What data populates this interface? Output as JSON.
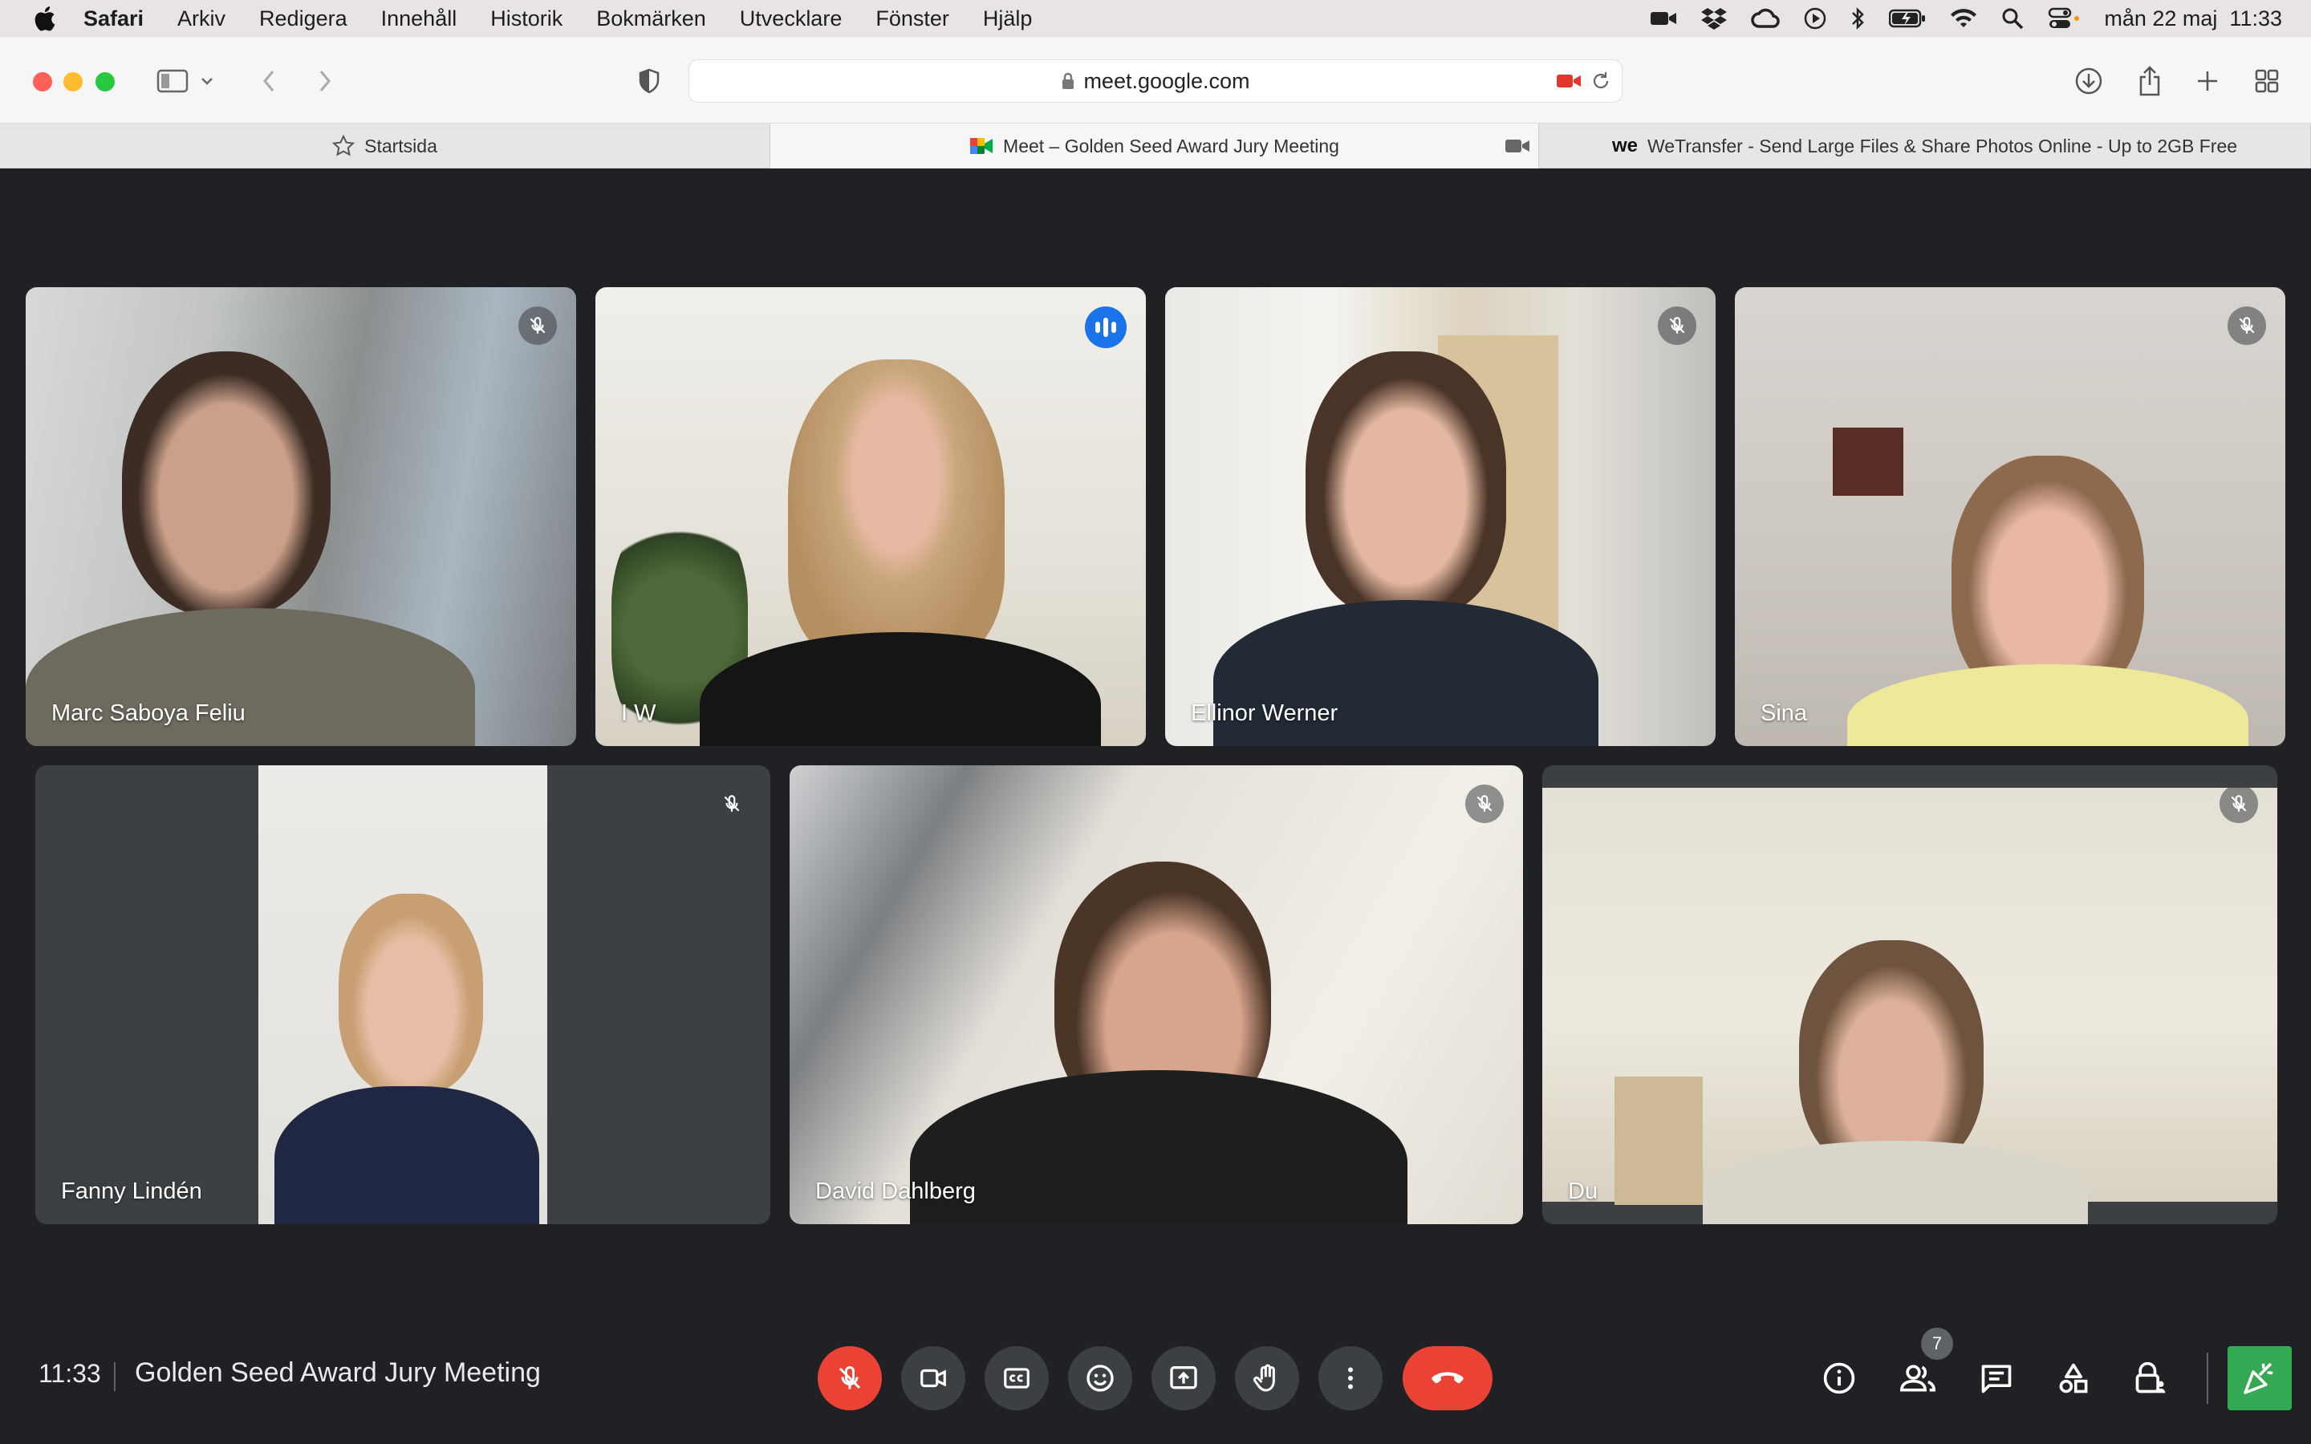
{
  "menubar": {
    "app_name": "Safari",
    "items": [
      "Arkiv",
      "Redigera",
      "Innehåll",
      "Historik",
      "Bokmärken",
      "Utvecklare",
      "Fönster",
      "Hjälp"
    ],
    "datetime": "mån 22 maj  11:33"
  },
  "browser": {
    "url": "meet.google.com",
    "tabs": [
      {
        "label": "Startsida",
        "icon": "star-icon"
      },
      {
        "label": "Meet – Golden Seed Award Jury Meeting",
        "icon": "meet-icon"
      },
      {
        "label": "WeTransfer - Send Large Files & Share Photos Online - Up to 2GB Free",
        "icon": "wetransfer-icon"
      }
    ],
    "wetransfer_logo": "we"
  },
  "participants": [
    {
      "name": "Marc Saboya Feliu",
      "muted": true
    },
    {
      "name": "I W",
      "muted": false,
      "speaking": true
    },
    {
      "name": "Ellinor Werner",
      "muted": true
    },
    {
      "name": "Sina",
      "muted": true
    },
    {
      "name": "Fanny Lindén",
      "muted": true
    },
    {
      "name": "David Dahlberg",
      "muted": true
    },
    {
      "name": "Du",
      "muted": true
    }
  ],
  "meeting": {
    "time": "11:33",
    "title": "Golden Seed Award Jury Meeting",
    "participant_count": "7"
  },
  "colors": {
    "background": "#202124",
    "accent": "#1a73e8",
    "danger": "#ea4335",
    "activities": "#34a853"
  }
}
